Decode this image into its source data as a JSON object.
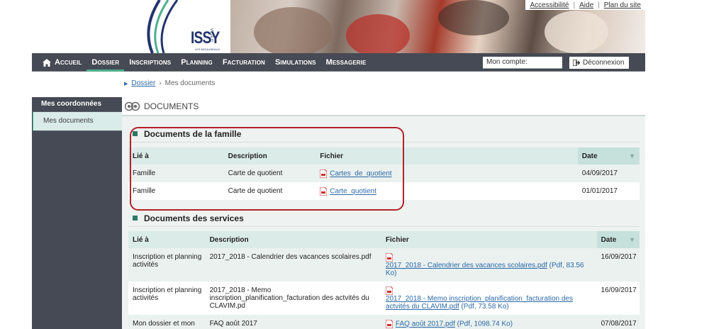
{
  "top_links": [
    "Accessibilité",
    "Aide",
    "Plan du site"
  ],
  "logo": {
    "text": "ISSY",
    "sub": "LES MOULINEAUX",
    "ville": "VILLE D'"
  },
  "nav": {
    "items": [
      "Accueil",
      "Dossier",
      "Inscriptions",
      "Planning",
      "Facturation",
      "Simulations",
      "Messagerie"
    ],
    "active": "Dossier",
    "account_label": "Mon compte:",
    "logout_label": "Déconnexion"
  },
  "breadcrumb": {
    "parent": "Dossier",
    "current": "Mes documents"
  },
  "sidebar": {
    "items": [
      "Mes coordonnées",
      "Mes documents"
    ],
    "active": "Mes documents"
  },
  "main": {
    "title": "DOCUMENTS",
    "family": {
      "heading": "Documents de la famille",
      "columns": [
        "Lié à",
        "Description",
        "Fichier",
        "Date"
      ],
      "rows": [
        {
          "lie": "Famille",
          "desc": "Carte de quotient",
          "file": "Cartes_de_quotient",
          "date": "04/09/2017"
        },
        {
          "lie": "Famille",
          "desc": "Carte de quotient",
          "file": "Carte_quotient",
          "date": "01/01/2017"
        }
      ]
    },
    "services": {
      "heading": "Documents des services",
      "columns": [
        "Lié à",
        "Description",
        "Fichier",
        "Date"
      ],
      "rows": [
        {
          "lie": "Inscription et planning activités",
          "desc": "2017_2018 - Calendrier des vacances scolaires.pdf",
          "file": "2017_2018 - Calendrier des vacances scolaires.pdf",
          "meta": "(Pdf, 83.56 Ko)",
          "date": "16/09/2017"
        },
        {
          "lie": "Inscription et planning activités",
          "desc": "2017_2018 - Memo inscription_planification_facturation des actvités du CLAVIM.pd",
          "file": "2017_2018 - Memo inscription_planification_facturation des actvités du CLAVIM.pdf",
          "meta": "(Pdf, 73.58 Ko)",
          "date": "16/09/2017"
        },
        {
          "lie": "Mon dossier et mon",
          "desc": "FAQ août 2017",
          "file": "FAQ août 2017.pdf",
          "meta": "(Pdf, 1098.74 Ko)",
          "date": "07/08/2017"
        }
      ]
    }
  }
}
